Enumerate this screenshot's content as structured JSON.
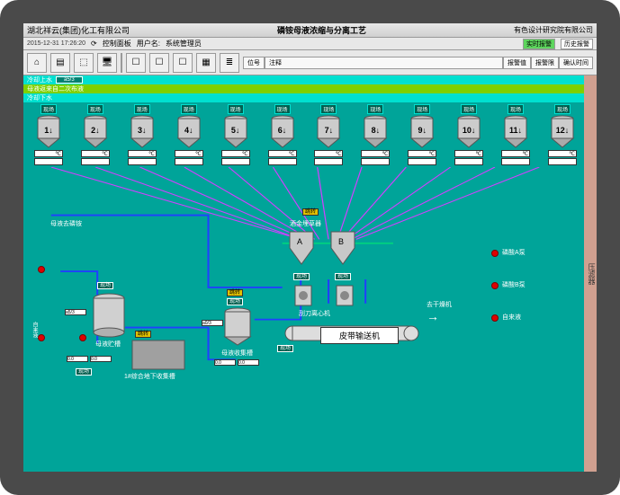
{
  "title": {
    "company": "湖北祥云(集团)化工有限公司",
    "process": "磷铵母液浓缩与分离工艺",
    "design": "有色设计研究院有限公司"
  },
  "menu": {
    "timestamp": "2015-12-31 17:26:20",
    "m1": "控制面板",
    "ulabel": "用户名:",
    "user": "系统管理员",
    "rt": "实时报警",
    "hist": "历史报警"
  },
  "cols": {
    "c1": "位号",
    "c2": "注释",
    "c3": "报警值",
    "c4": "报警限",
    "c5": "确认时间"
  },
  "strips": {
    "s1": "冷却上水",
    "s2": "母液返来自二次布液",
    "s3": "冷却下水",
    "box": "a5/3"
  },
  "side": "压滤器",
  "tanks": [
    {
      "n": "1",
      "top": "现场"
    },
    {
      "n": "2",
      "top": "现场"
    },
    {
      "n": "3",
      "top": "现场"
    },
    {
      "n": "4",
      "top": "现场"
    },
    {
      "n": "5",
      "top": "现场"
    },
    {
      "n": "6",
      "top": "现场"
    },
    {
      "n": "7",
      "top": "现场"
    },
    {
      "n": "8",
      "top": "现场"
    },
    {
      "n": "9",
      "top": "现场"
    },
    {
      "n": "10",
      "top": "现场"
    },
    {
      "n": "11",
      "top": "现场"
    },
    {
      "n": "12",
      "top": "现场"
    }
  ],
  "labels": {
    "l1": "母液去磷铵",
    "l2": "酒金埋草器",
    "l3": "母液贮槽",
    "l4": "1#综合地下收集槽",
    "l5": "母液收集槽",
    "l6": "刮刀离心机",
    "l7": "去干燥机",
    "l8": "皮带输送机",
    "l9": "磷酸A泵",
    "l10": "磷酸B泵",
    "l11": "自来液",
    "a": "A",
    "b": "B",
    "loc": "现场",
    "run": "跳转",
    "val00": "0.0",
    "valm": "a5/3",
    "valm2": "a0/3"
  }
}
